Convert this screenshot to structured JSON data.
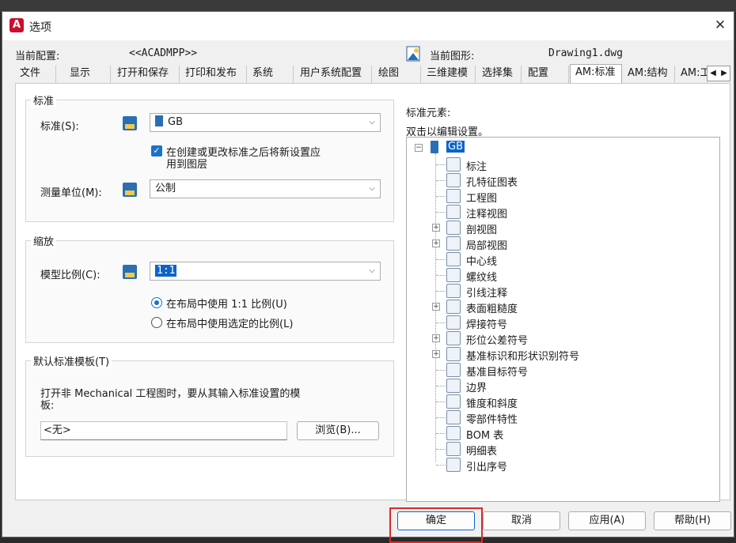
{
  "window": {
    "title": "选项",
    "close": "✕"
  },
  "config": {
    "current_config_label": "当前配置:",
    "current_config_value": "<<ACADMPP>>",
    "current_drawing_label": "当前图形:",
    "current_drawing_value": "Drawing1.dwg"
  },
  "tabs": [
    {
      "label": "文件"
    },
    {
      "label": "显示"
    },
    {
      "label": "打开和保存"
    },
    {
      "label": "打印和发布"
    },
    {
      "label": "系统"
    },
    {
      "label": "用户系统配置"
    },
    {
      "label": "绘图"
    },
    {
      "label": "三维建模"
    },
    {
      "label": "选择集"
    },
    {
      "label": "配置"
    },
    {
      "label": "AM:标准"
    },
    {
      "label": "AM:结构"
    },
    {
      "label": "AM:工"
    }
  ],
  "standard_group": {
    "title": "标准",
    "standard_label": "标准(S):",
    "standard_value": "GB",
    "apply_checkbox_line1": "在创建或更改标准之后将新设置应",
    "apply_checkbox_line2": "用到图层",
    "apply_checked": true,
    "unit_label": "测量单位(M):",
    "unit_value": "公制"
  },
  "scale_group": {
    "title": "缩放",
    "model_scale_label": "模型比例(C):",
    "model_scale_value": "1:1",
    "radio1": "在布局中使用 1:1 比例(U)",
    "radio2": "在布局中使用选定的比例(L)",
    "selected_radio": 1
  },
  "template_group": {
    "title": "默认标准模板(T)",
    "desc_line1": "打开非 Mechanical 工程图时，要从其输入标准设置的模",
    "desc_line2": "板:",
    "path_value": "<无>",
    "browse_button": "浏览(B)..."
  },
  "tree": {
    "label": "标准元素:",
    "hint": "双击以编辑设置。",
    "root": "GB",
    "items": [
      {
        "label": "标注",
        "icon": "dimension-icon",
        "expandable": false
      },
      {
        "label": "孔特征图表",
        "icon": "hole-chart-icon",
        "expandable": false
      },
      {
        "label": "工程图",
        "icon": "drawing-icon",
        "expandable": false
      },
      {
        "label": "注释视图",
        "icon": "annotation-view-icon",
        "expandable": false
      },
      {
        "label": "剖视图",
        "icon": "section-view-icon",
        "expandable": true
      },
      {
        "label": "局部视图",
        "icon": "detail-view-icon",
        "expandable": true
      },
      {
        "label": "中心线",
        "icon": "centerline-icon",
        "expandable": false
      },
      {
        "label": "螺纹线",
        "icon": "thread-icon",
        "expandable": false
      },
      {
        "label": "引线注释",
        "icon": "leader-note-icon",
        "expandable": false
      },
      {
        "label": "表面粗糙度",
        "icon": "surface-texture-icon",
        "expandable": true
      },
      {
        "label": "焊接符号",
        "icon": "weld-symbol-icon",
        "expandable": false
      },
      {
        "label": "形位公差符号",
        "icon": "fcf-icon",
        "expandable": true
      },
      {
        "label": "基准标识和形状识别符号",
        "icon": "datum-id-icon",
        "expandable": true
      },
      {
        "label": "基准目标符号",
        "icon": "datum-target-icon",
        "expandable": false
      },
      {
        "label": "边界",
        "icon": "edge-icon",
        "expandable": false
      },
      {
        "label": "锥度和斜度",
        "icon": "taper-slope-icon",
        "expandable": false
      },
      {
        "label": "零部件特性",
        "icon": "component-props-icon",
        "expandable": false
      },
      {
        "label": "BOM 表",
        "icon": "bom-icon",
        "expandable": false
      },
      {
        "label": "明细表",
        "icon": "parts-list-icon",
        "expandable": false
      },
      {
        "label": "引出序号",
        "icon": "balloon-icon",
        "expandable": false
      }
    ]
  },
  "footer": {
    "ok": "确定",
    "cancel": "取消",
    "apply": "应用(A)",
    "help": "帮助(H)"
  },
  "colors": {
    "accent": "#0a64c8",
    "highlight_red": "#d92a2a",
    "app_red": "#c8102e"
  }
}
